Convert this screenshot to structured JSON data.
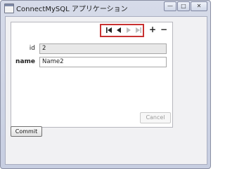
{
  "window": {
    "title": "ConnectMySQL アプリケーション",
    "minimize_glyph": "—",
    "maximize_glyph": "□",
    "close_glyph": "✕"
  },
  "navigator": {
    "first_icon": "first-record-icon",
    "previous_icon": "previous-record-icon",
    "next_icon": "next-record-icon",
    "last_icon": "last-record-icon",
    "add_label": "+",
    "delete_label": "−",
    "highlight_color": "#c83232"
  },
  "form": {
    "fields": [
      {
        "label": "id",
        "value": "2",
        "readonly": true
      },
      {
        "label": "name",
        "value": "Name2",
        "readonly": false
      }
    ],
    "cancel_label": "Cancel"
  },
  "commit_label": "Commit"
}
